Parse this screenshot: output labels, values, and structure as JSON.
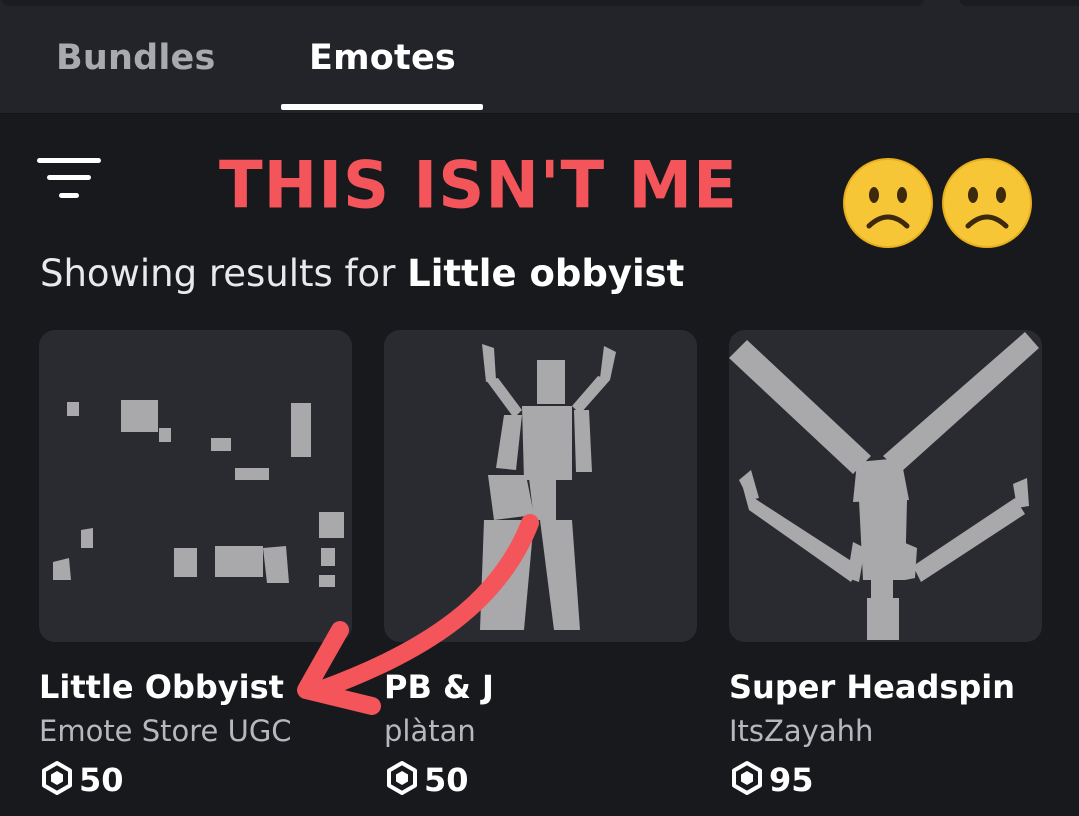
{
  "tabs": {
    "bundles_label": "Bundles",
    "emotes_label": "Emotes",
    "active": "Emotes"
  },
  "annotation": {
    "text": "THIS ISN'T ME",
    "emojis": [
      "frowning-face",
      "frowning-face"
    ],
    "color": "#f4555a"
  },
  "search": {
    "prefix": "Showing results for ",
    "query": "Little obbyist"
  },
  "items": [
    {
      "name": "Little Obbyist",
      "creator": "Emote Store UGC",
      "price": "50",
      "currency_icon": "robux-icon"
    },
    {
      "name": "PB & J",
      "creator": "plàtan",
      "price": "50",
      "currency_icon": "robux-icon"
    },
    {
      "name": "Super Headspin",
      "creator": "ItsZayahh",
      "price": "95",
      "currency_icon": "robux-icon"
    }
  ],
  "colors": {
    "background": "#18191d",
    "header": "#232429",
    "card": "#2a2b31",
    "figure": "#a9a9ab",
    "accent_red": "#f4555a"
  }
}
